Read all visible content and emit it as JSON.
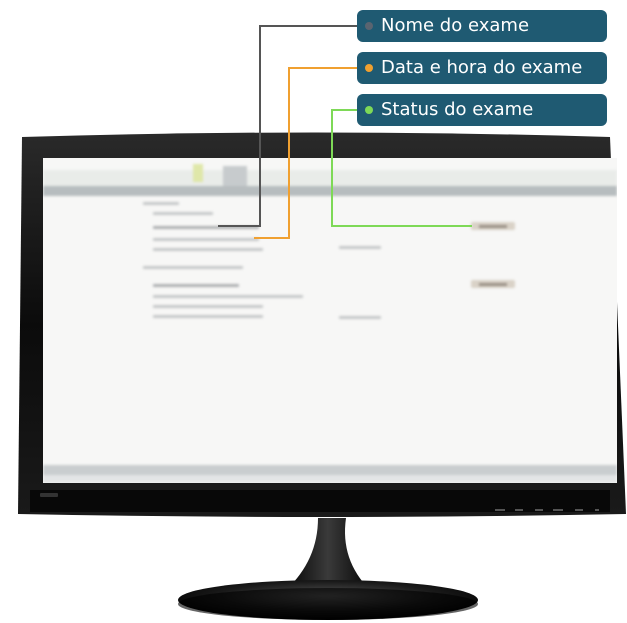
{
  "callouts": [
    {
      "label": "Nome do exame",
      "dot_color": "#5a6470"
    },
    {
      "label": "Data e hora do exame",
      "dot_color": "#f0a030"
    },
    {
      "label": "Status do exame",
      "dot_color": "#7ed957"
    }
  ],
  "colors": {
    "callout_bg": "#1f5a72",
    "connector_name": "#555555",
    "connector_datetime": "#f0a030",
    "connector_status": "#7ed957",
    "monitor_body": "#111111"
  },
  "screen": {
    "content": "blurred exam list"
  }
}
